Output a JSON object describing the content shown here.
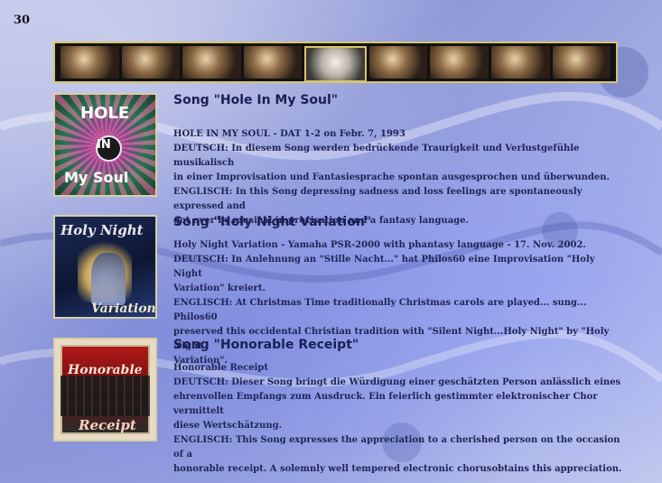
{
  "page": {
    "number": "30"
  },
  "entries": [
    {
      "title": "Song \"Hole In My Soul\"",
      "cover": {
        "line1": "HOLE",
        "line2": "IN",
        "line3": "My Soul"
      },
      "lines": [
        "HOLE IN MY SOUL - DAT 1-2  on Febr. 7, 1993",
        "DEUTSCH: In diesem Song werden bedrückende Traurigkeit und Verlustgefühle musikalisch",
        "in einer Improvisation und Fantasiesprache spontan ausgesprochen und überwunden.",
        "ENGLISCH: In this Song depressing sadness and loss feelings are spontaneously expressed and",
        "got over by musical improvisation and a fantasy language."
      ]
    },
    {
      "title": "Song \"Holy Night Variation\"",
      "cover": {
        "line1": "Holy Night",
        "line2": "Variation"
      },
      "lines": [
        "Holy Night Variation - Yamaha PSR-2000 with phantasy language - 17. Nov. 2002.",
        "DEUTSCH: In Anlehnung an \"Stille Nacht...\"  hat Philos60 eine Improvisation \"Holy Night",
        "Variation\" kreiert.",
        "ENGLISCH: At Christmas Time traditionally Christmas carols are played... sung... Philos60",
        "preserved this occidental Christian tradition with \"Silent Night...Holy Night\" by \"Holy Night",
        "Variation\"."
      ]
    },
    {
      "title": "Song \"Honorable Receipt\"",
      "cover": {
        "line1": "Honorable",
        "line2": "Receipt"
      },
      "lines": [
        "Honorable Receipt",
        "DEUTSCH: Dieser Song bringt die Würdigung einer geschätzten Person anlässlich eines",
        "ehrenvollen Empfangs zum Ausdruck. Ein feierlich gestimmter elektronischer Chor vermittelt",
        "diese Wertschätzung.",
        "ENGLISCH: This Song expresses the appreciation to a cherished person on the occasion of a",
        "honorable receipt. A solemnly well tempered electronic chorusobtains this appreciation."
      ]
    }
  ],
  "colors": {
    "text": "#202457",
    "title": "#1c1f55",
    "frame_border": "#d8c46a"
  }
}
